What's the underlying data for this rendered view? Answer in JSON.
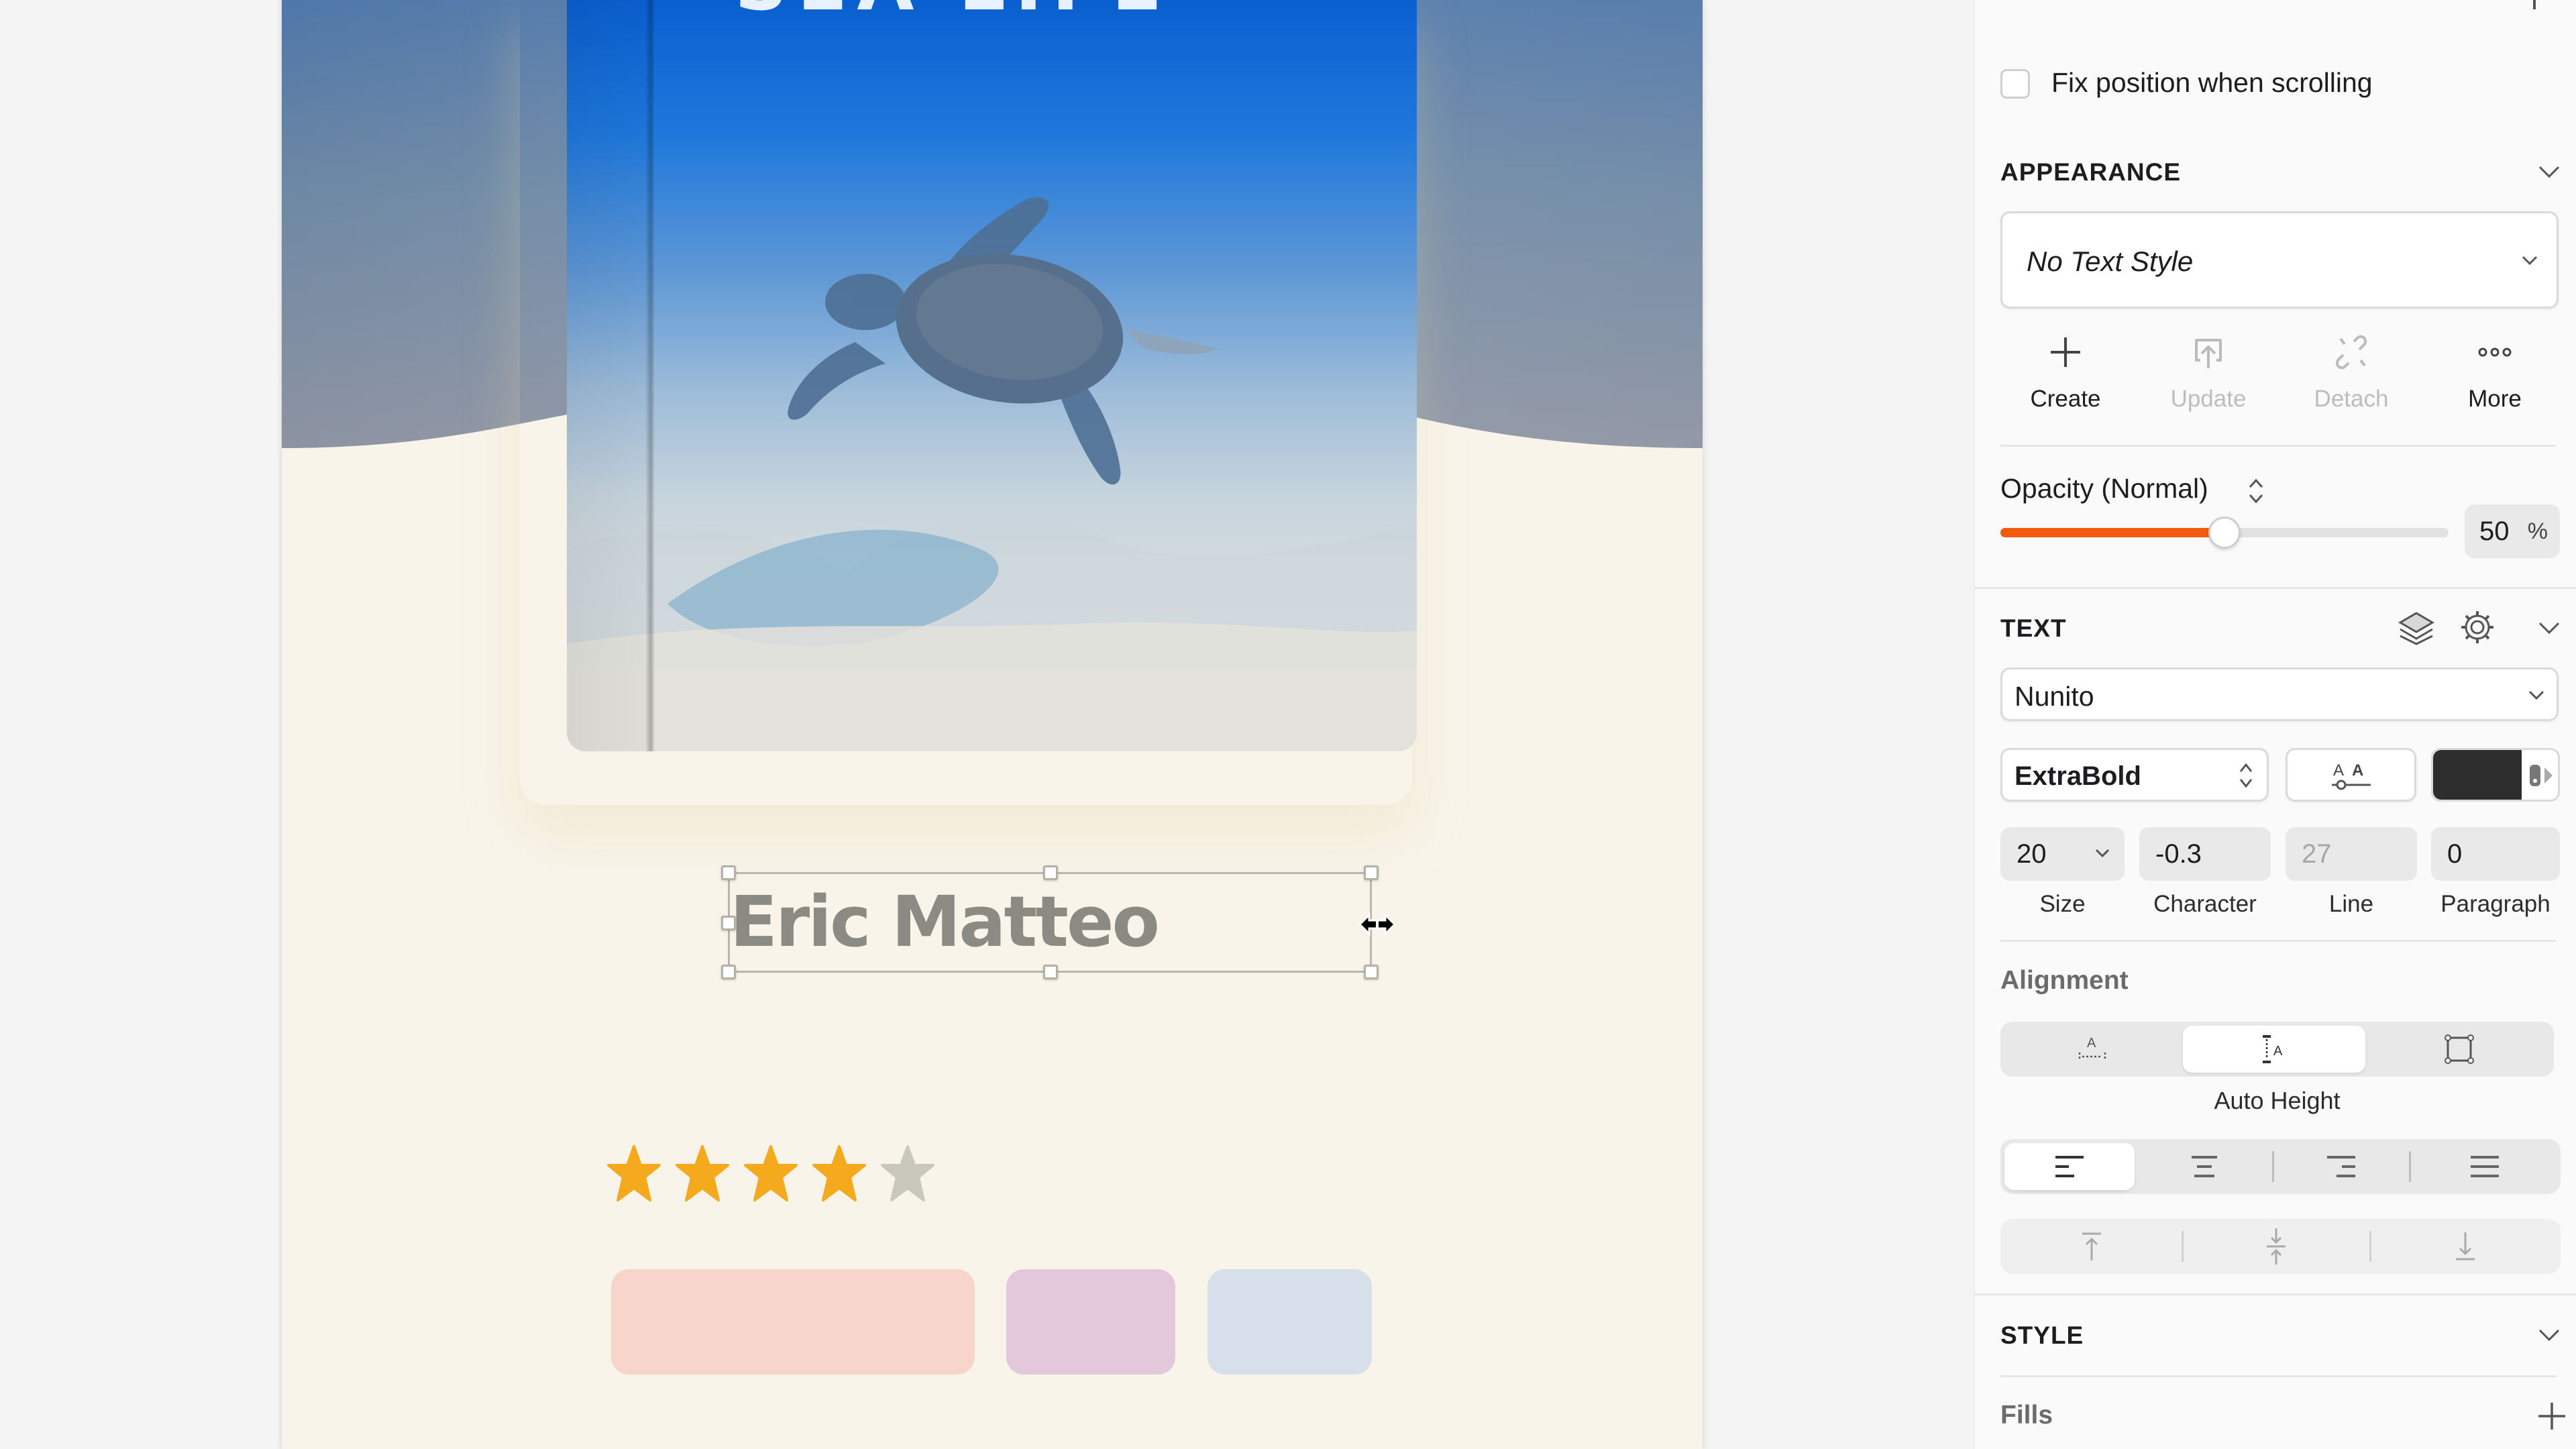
{
  "canvas": {
    "book_title": "SEA LIFE",
    "selected_text": "Eric Matteo",
    "rating": {
      "value": 4,
      "max": 5,
      "filled_color": "#f5a91c",
      "empty_color": "#c9c8bd"
    },
    "swatches": [
      {
        "name": "pink",
        "color": "#f8d5cb"
      },
      {
        "name": "purple",
        "color": "#e3c8dc"
      },
      {
        "name": "blue",
        "color": "#d7dfeb"
      }
    ],
    "page_background": "#f8f4ea",
    "text_color": "#8b8a83"
  },
  "panel": {
    "fix_position_label": "Fix position when scrolling",
    "fix_position_checked": false,
    "appearance": {
      "title": "APPEARANCE",
      "text_style_value": "No Text Style",
      "actions": [
        {
          "label": "Create",
          "icon": "plus-icon",
          "enabled": true
        },
        {
          "label": "Update",
          "icon": "upload-icon",
          "enabled": false
        },
        {
          "label": "Detach",
          "icon": "unlink-icon",
          "enabled": false
        },
        {
          "label": "More",
          "icon": "more-icon",
          "enabled": true
        }
      ],
      "opacity_label": "Opacity (Normal)",
      "opacity_value": "50",
      "opacity_unit": "%",
      "opacity_fraction": 0.5,
      "accent_color": "#f25a0c"
    },
    "text": {
      "title": "TEXT",
      "font_family": "Nunito",
      "font_weight": "ExtraBold",
      "color_value": "#2d2d2d",
      "size": "20",
      "character": "-0.3",
      "line": "27",
      "paragraph": "0",
      "captions": {
        "size": "Size",
        "character": "Character",
        "line": "Line",
        "paragraph": "Paragraph"
      },
      "alignment_label": "Alignment",
      "sizing_modes": [
        "Auto Width",
        "Auto Height",
        "Fixed Size"
      ],
      "sizing_active": "Auto Height",
      "horizontal_align": [
        "left",
        "center",
        "right",
        "justify"
      ],
      "horizontal_active": "left",
      "vertical_align": [
        "top",
        "middle",
        "bottom"
      ]
    },
    "style": {
      "title": "STYLE",
      "fills_label": "Fills"
    }
  }
}
